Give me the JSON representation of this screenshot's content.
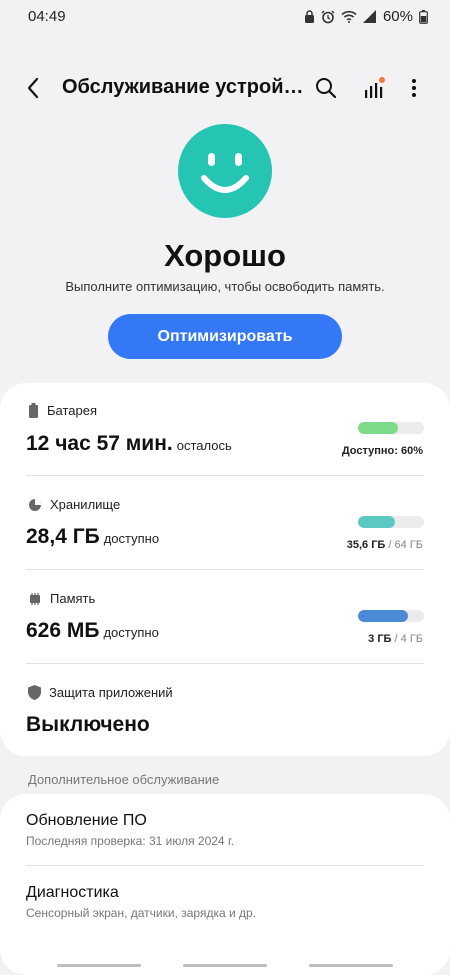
{
  "status_bar": {
    "time": "04:49",
    "battery_percent": "60%",
    "icons": [
      "lock-icon",
      "alarm-icon",
      "wifi-icon",
      "signal-icon",
      "battery-icon"
    ]
  },
  "app_bar": {
    "title": "Обслуживание устройства",
    "icons": [
      "back-icon",
      "search-icon",
      "bar-chart-icon",
      "more-vert-icon"
    ],
    "notification_dot_color": "#f07a3a"
  },
  "hero": {
    "status": "Хорошо",
    "subtitle": "Выполните оптимизацию, чтобы освободить память.",
    "optimize_label": "Оптимизировать",
    "smiley_color": "#26c4b3",
    "button_color": "#3478f6"
  },
  "items": {
    "battery": {
      "label": "Батарея",
      "value": "12 час 57 мин.",
      "suffix": "осталось",
      "caption": "Доступно: 60%",
      "level": 0.6,
      "color": "#7ddb8a"
    },
    "storage": {
      "label": "Хранилище",
      "value": "28,4 ГБ",
      "suffix": "доступно",
      "caption_used": "35,6 ГБ",
      "caption_total": "/ 64 ГБ",
      "level": 0.556,
      "color": "#5cc8c2"
    },
    "memory": {
      "label": "Память",
      "value": "626 МБ",
      "suffix": "доступно",
      "caption_used": "3 ГБ",
      "caption_total": "/ 4 ГБ",
      "level": 0.75,
      "color": "#4a8ad6"
    },
    "app_protection": {
      "label": "Защита приложений",
      "value": "Выключено"
    }
  },
  "additional": {
    "header": "Дополнительное обслуживание",
    "software_update": {
      "title": "Обновление ПО",
      "subtitle": "Последняя проверка: 31 июля 2024 г."
    },
    "diagnostics": {
      "title": "Диагностика",
      "subtitle": "Сенсорный экран, датчики, зарядка и др."
    }
  }
}
